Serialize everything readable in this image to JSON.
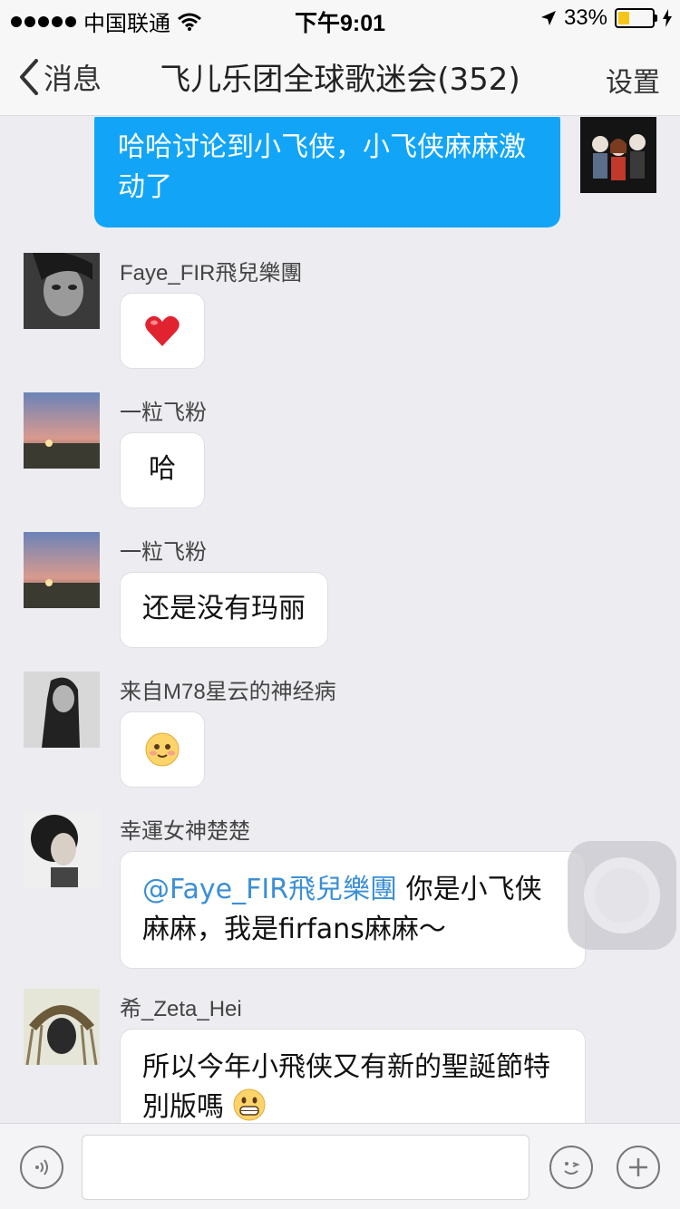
{
  "status_bar": {
    "carrier": "中国联通",
    "time": "下午9:01",
    "battery_percent_label": "33%",
    "battery_level": 0.33,
    "battery_color": "#f5c518"
  },
  "nav": {
    "back_label": "消息",
    "title": "飞儿乐团全球歌迷会(352)",
    "settings_label": "设置"
  },
  "colors": {
    "self_bubble": "#12a5f7",
    "mention": "#3b8fd6",
    "background": "#ececf1"
  },
  "messages": [
    {
      "sender": "",
      "text": "哈哈讨论到小飞侠，小飞侠麻麻激动了",
      "self": true
    },
    {
      "sender": "Faye_FIR飛兒樂團",
      "emoji": "heart-emoji"
    },
    {
      "sender": "一粒飞粉",
      "text": "哈"
    },
    {
      "sender": "一粒飞粉",
      "text": "还是没有玛丽"
    },
    {
      "sender": "来自M78星云的神经病",
      "emoji": "blushing-smile-emoji"
    },
    {
      "sender": "幸運女神楚楚",
      "mention": "@Faye_FIR飛兒樂團",
      "text": " 你是小飞侠麻麻，我是firfans麻麻～"
    },
    {
      "sender": "希_Zeta_Hei",
      "text": "所以今年小飛侠又有新的聖誕節特別版嗎"
    }
  ],
  "input_bar": {
    "voice_icon": "voice-icon",
    "emoji_icon": "emoji-icon",
    "plus_icon": "plus-icon"
  }
}
